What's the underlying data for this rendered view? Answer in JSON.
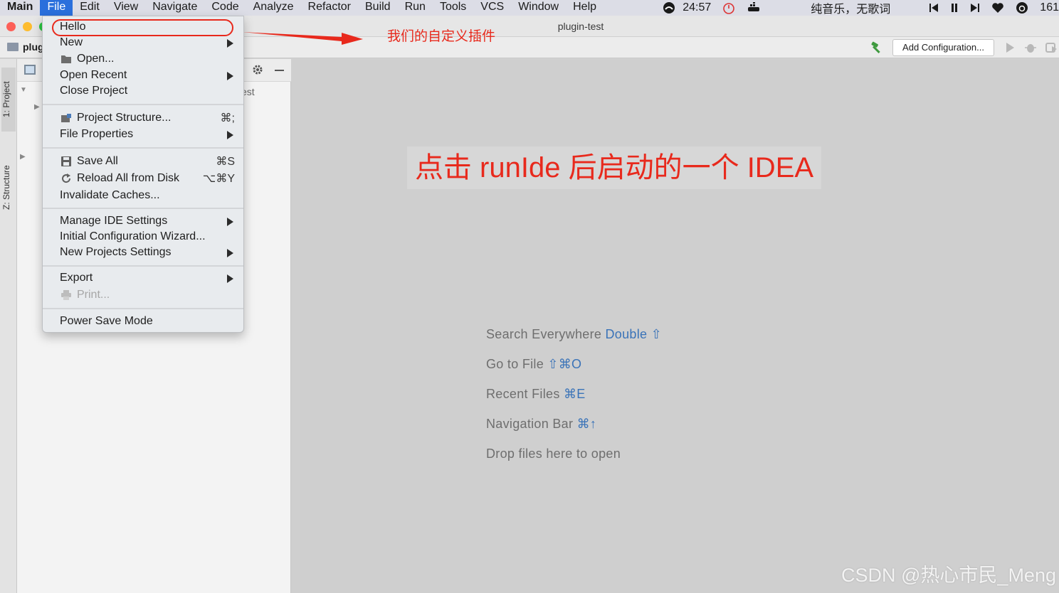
{
  "menubar": {
    "app": "Main",
    "items": [
      "File",
      "Edit",
      "View",
      "Navigate",
      "Code",
      "Analyze",
      "Refactor",
      "Build",
      "Run",
      "Tools",
      "VCS",
      "Window",
      "Help"
    ],
    "active_index": 0,
    "time": "24:57",
    "music": "纯音乐，无歌词",
    "battery": "161"
  },
  "window": {
    "title": "plugin-test"
  },
  "toolbar": {
    "project_crumb": "plug",
    "add_configuration": "Add Configuration..."
  },
  "stripe": {
    "project": "1: Project",
    "structure": "Z: Structure"
  },
  "project_panel": {
    "partial_text": "est"
  },
  "file_menu": {
    "items": [
      {
        "label": "Hello"
      },
      {
        "label": "New",
        "submenu": true
      },
      {
        "label": "Open...",
        "icon": "folder-open-icon"
      },
      {
        "label": "Open Recent",
        "submenu": true
      },
      {
        "label": "Close Project"
      },
      {
        "label": "Project Structure...",
        "icon": "project-structure-icon",
        "shortcut": "⌘;"
      },
      {
        "label": "File Properties",
        "submenu": true
      },
      {
        "label": "Save All",
        "icon": "save-icon",
        "shortcut": "⌘S"
      },
      {
        "label": "Reload All from Disk",
        "icon": "reload-icon",
        "shortcut": "⌥⌘Y"
      },
      {
        "label": "Invalidate Caches..."
      },
      {
        "label": "Manage IDE Settings",
        "submenu": true
      },
      {
        "label": "Initial Configuration Wizard..."
      },
      {
        "label": "New Projects Settings",
        "submenu": true
      },
      {
        "label": "Export",
        "submenu": true
      },
      {
        "label": "Print...",
        "icon": "print-icon",
        "disabled": true
      },
      {
        "label": "Power Save Mode"
      }
    ]
  },
  "editor_hints": [
    {
      "text": "Search Everywhere",
      "key": "Double ⇧"
    },
    {
      "text": "Go to File",
      "key": "⇧⌘O"
    },
    {
      "text": "Recent Files",
      "key": "⌘E"
    },
    {
      "text": "Navigation Bar",
      "key": "⌘↑"
    },
    {
      "text": "Drop files here to open",
      "key": ""
    }
  ],
  "annotations": {
    "custom_plugin": "我们的自定义插件",
    "runide_note": "点击 runIde 后启动的一个 IDEA",
    "accent_color": "#e8291c"
  },
  "watermark": "CSDN @热心市民_Meng"
}
